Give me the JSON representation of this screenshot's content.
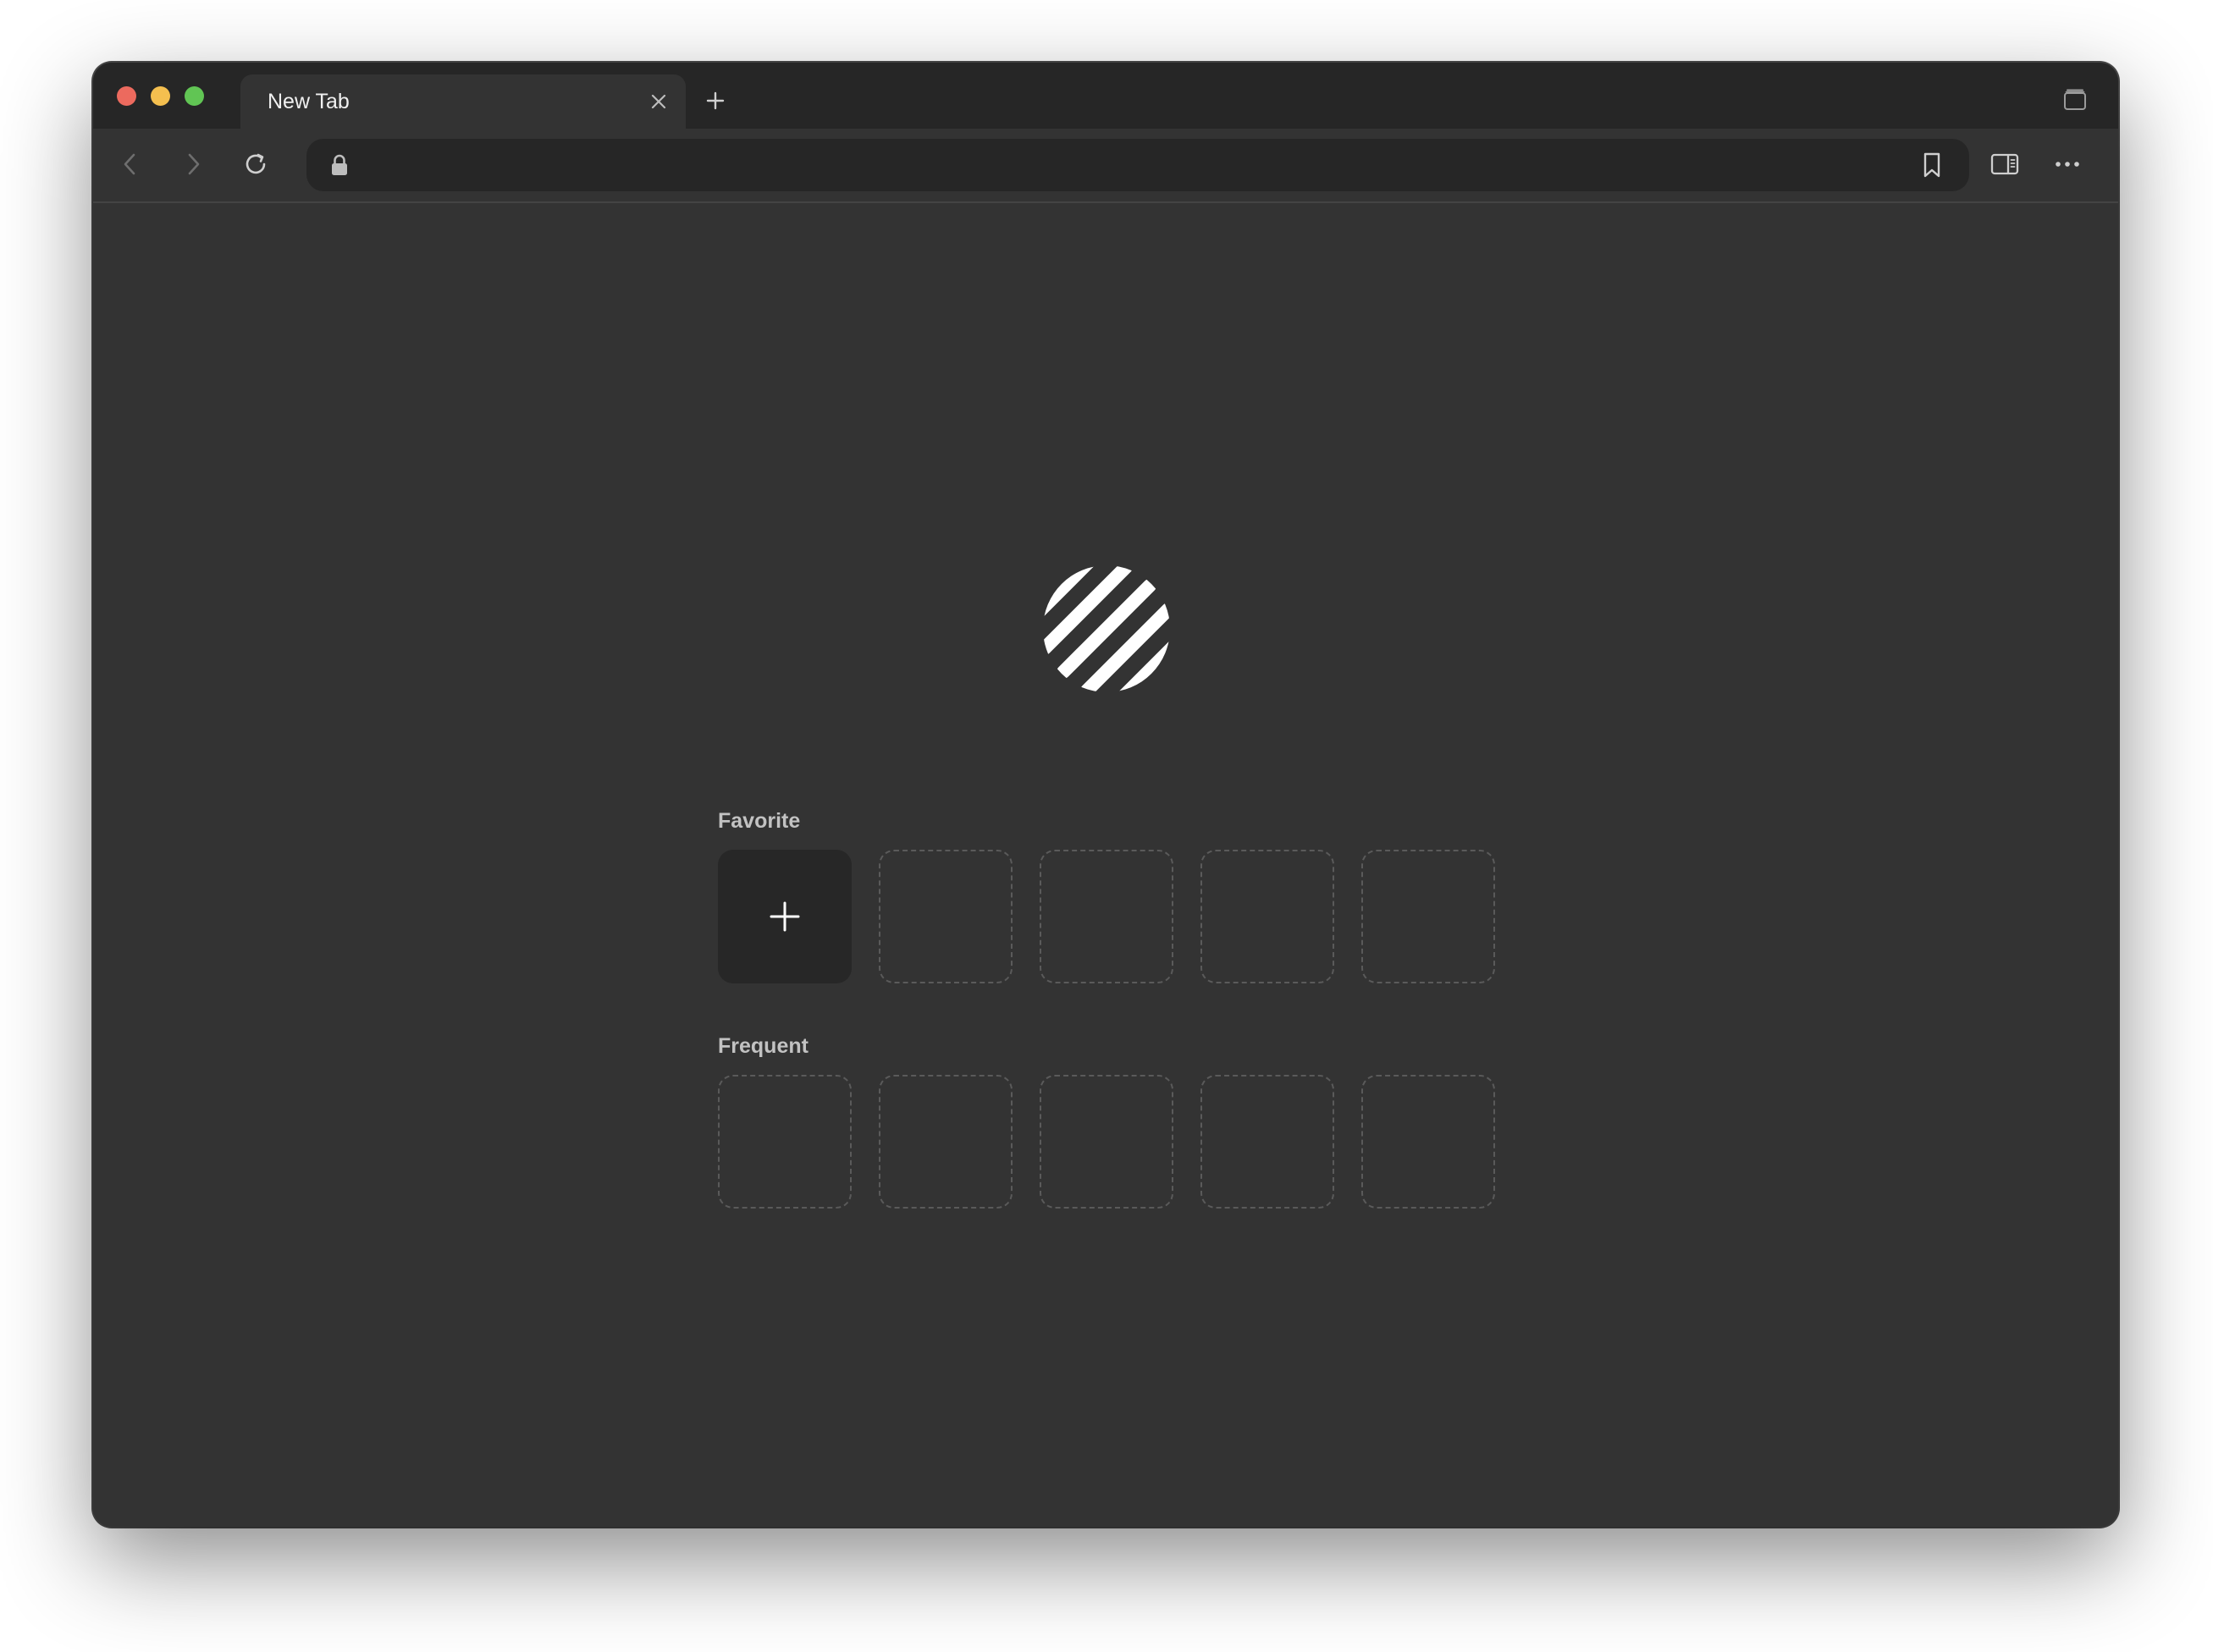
{
  "tab": {
    "title": "New Tab"
  },
  "address_bar": {
    "value": "",
    "placeholder": ""
  },
  "sections": {
    "favorite": {
      "label": "Favorite"
    },
    "frequent": {
      "label": "Frequent"
    }
  },
  "icons": {
    "traffic_lights": [
      "close",
      "minimize",
      "maximize"
    ],
    "toolbar": [
      "back-arrow",
      "forward-arrow",
      "reload",
      "lock",
      "bookmark",
      "sidebar",
      "more"
    ],
    "tabstrip": [
      "tab-close",
      "new-tab-plus",
      "tab-overview"
    ],
    "logo": "striped-circle-logo",
    "add_tile": "plus"
  },
  "colors": {
    "window_bg": "#333333",
    "tabstrip_bg": "#262626",
    "address_bg": "#262626",
    "traffic_close": "#ec6a5e",
    "traffic_minimize": "#f4bf4f",
    "traffic_maximize": "#61c554",
    "label_text": "#c2c2c2"
  }
}
